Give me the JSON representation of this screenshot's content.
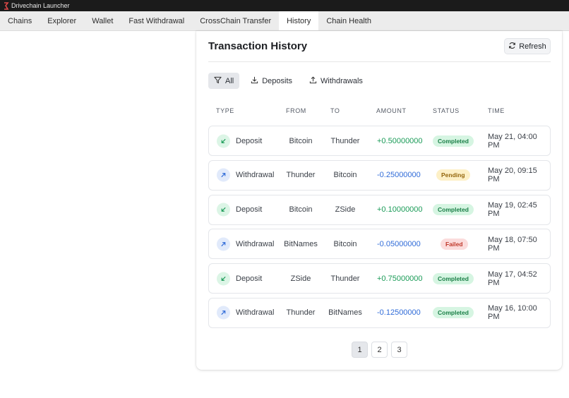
{
  "window": {
    "title": "Drivechain Launcher",
    "icon": "drivechain-logo-icon"
  },
  "tabs": [
    {
      "label": "Chains",
      "active": false
    },
    {
      "label": "Explorer",
      "active": false
    },
    {
      "label": "Wallet",
      "active": false
    },
    {
      "label": "Fast Withdrawal",
      "active": false
    },
    {
      "label": "CrossChain Transfer",
      "active": false
    },
    {
      "label": "History",
      "active": true
    },
    {
      "label": "Chain Health",
      "active": false
    }
  ],
  "history": {
    "title": "Transaction History",
    "refresh_label": "Refresh",
    "refresh_icon": "refresh-icon",
    "filters": [
      {
        "label": "All",
        "icon": "filter-icon",
        "active": true
      },
      {
        "label": "Deposits",
        "icon": "download-icon",
        "active": false
      },
      {
        "label": "Withdrawals",
        "icon": "upload-icon",
        "active": false
      }
    ],
    "columns": {
      "type": "TYPE",
      "from": "FROM",
      "to": "TO",
      "amount": "AMOUNT",
      "status": "STATUS",
      "time": "TIME"
    },
    "rows": [
      {
        "type": "Deposit",
        "from": "Bitcoin",
        "to": "Thunder",
        "amount": "+0.50000000",
        "status": "Completed",
        "time": "May 21, 04:00 PM"
      },
      {
        "type": "Withdrawal",
        "from": "Thunder",
        "to": "Bitcoin",
        "amount": "-0.25000000",
        "status": "Pending",
        "time": "May 20, 09:15 PM"
      },
      {
        "type": "Deposit",
        "from": "Bitcoin",
        "to": "ZSide",
        "amount": "+0.10000000",
        "status": "Completed",
        "time": "May 19, 02:45 PM"
      },
      {
        "type": "Withdrawal",
        "from": "BitNames",
        "to": "Bitcoin",
        "amount": "-0.05000000",
        "status": "Failed",
        "time": "May 18, 07:50 PM"
      },
      {
        "type": "Deposit",
        "from": "ZSide",
        "to": "Thunder",
        "amount": "+0.75000000",
        "status": "Completed",
        "time": "May 17, 04:52 PM"
      },
      {
        "type": "Withdrawal",
        "from": "Thunder",
        "to": "BitNames",
        "amount": "-0.12500000",
        "status": "Completed",
        "time": "May 16, 10:00 PM"
      }
    ],
    "pagination": {
      "pages": [
        "1",
        "2",
        "3"
      ],
      "current": "1"
    }
  },
  "colors": {
    "deposit": "#1a9b57",
    "withdrawal": "#2f6bd8",
    "completed": "#1a7f47",
    "pending": "#94660c",
    "failed": "#c0392b"
  }
}
